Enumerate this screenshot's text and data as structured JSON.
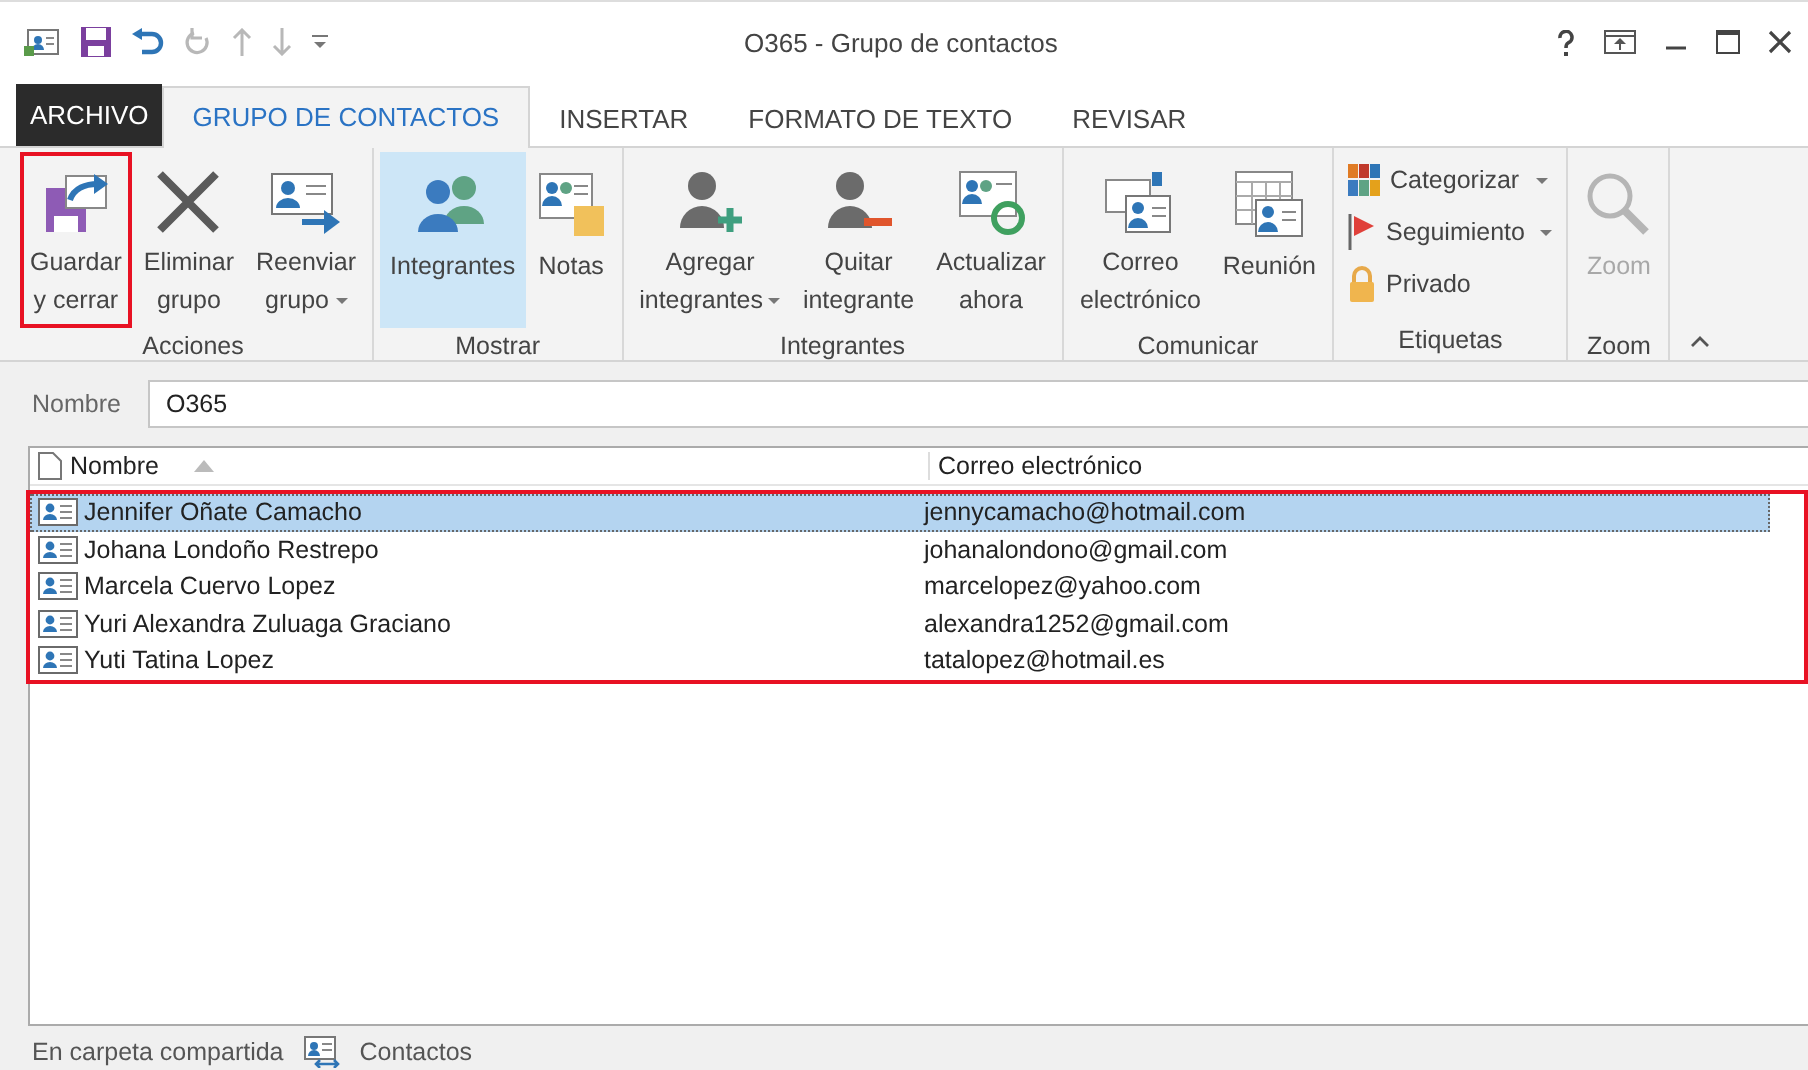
{
  "window": {
    "title": "O365 - Grupo de contactos"
  },
  "tabs": [
    {
      "label": "ARCHIVO",
      "kind": "file",
      "selected": false
    },
    {
      "label": "GRUPO DE CONTACTOS",
      "kind": "tab",
      "selected": true
    },
    {
      "label": "INSERTAR",
      "kind": "tab",
      "selected": false
    },
    {
      "label": "FORMATO DE TEXTO",
      "kind": "tab",
      "selected": false
    },
    {
      "label": "REVISAR",
      "kind": "tab",
      "selected": false
    }
  ],
  "ribbon": {
    "groups": [
      {
        "label": "Acciones",
        "buttons": [
          {
            "kind": "large",
            "lines": [
              "Guardar",
              "y cerrar"
            ],
            "highlighted": true
          },
          {
            "kind": "large",
            "lines": [
              "Eliminar",
              "grupo"
            ]
          },
          {
            "kind": "large",
            "lines": [
              "Reenviar",
              "grupo"
            ],
            "dropdown": true
          }
        ]
      },
      {
        "label": "Mostrar",
        "buttons": [
          {
            "kind": "large",
            "lines": [
              "Integrantes"
            ],
            "selected": true
          },
          {
            "kind": "large",
            "lines": [
              "Notas"
            ],
            "selected": false
          }
        ]
      },
      {
        "label": "Integrantes",
        "buttons": [
          {
            "kind": "large",
            "lines": [
              "Agregar",
              "integrantes"
            ],
            "dropdown": true
          },
          {
            "kind": "large",
            "lines": [
              "Quitar",
              "integrante"
            ]
          },
          {
            "kind": "large",
            "lines": [
              "Actualizar",
              "ahora"
            ]
          }
        ]
      },
      {
        "label": "Comunicar",
        "buttons": [
          {
            "kind": "large",
            "lines": [
              "Correo",
              "electrónico"
            ]
          },
          {
            "kind": "large",
            "lines": [
              "Reunión"
            ]
          }
        ]
      },
      {
        "label": "Etiquetas",
        "buttons": [
          {
            "kind": "small",
            "lines": [
              "Categorizar"
            ],
            "dropdown": true
          },
          {
            "kind": "small",
            "lines": [
              "Seguimiento"
            ],
            "dropdown": true
          },
          {
            "kind": "small",
            "lines": [
              "Privado"
            ]
          }
        ]
      },
      {
        "label": "Zoom",
        "buttons": [
          {
            "kind": "large",
            "lines": [
              "Zoom"
            ],
            "disabled": true
          }
        ]
      }
    ]
  },
  "name_field": {
    "label": "Nombre",
    "value": "O365"
  },
  "members": {
    "highlighted": true,
    "columns": [
      {
        "label": "Nombre",
        "sorted": true
      },
      {
        "label": "Correo electrónico",
        "sorted": false
      }
    ],
    "rows": [
      {
        "name": "Jennifer Oñate Camacho",
        "email": "jennycamacho@hotmail.com",
        "selected": true
      },
      {
        "name": "Johana Londoño Restrepo",
        "email": "johanalondono@gmail.com",
        "selected": false
      },
      {
        "name": "Marcela Cuervo Lopez",
        "email": "marcelopez@yahoo.com",
        "selected": false
      },
      {
        "name": "Yuri Alexandra Zuluaga Graciano",
        "email": "alexandra1252@gmail.com",
        "selected": false
      },
      {
        "name": "Yuti Tatina Lopez",
        "email": "tatalopez@hotmail.es",
        "selected": false
      }
    ]
  },
  "status_bar": {
    "location_label": "En carpeta compartida",
    "folder": "Contactos"
  }
}
